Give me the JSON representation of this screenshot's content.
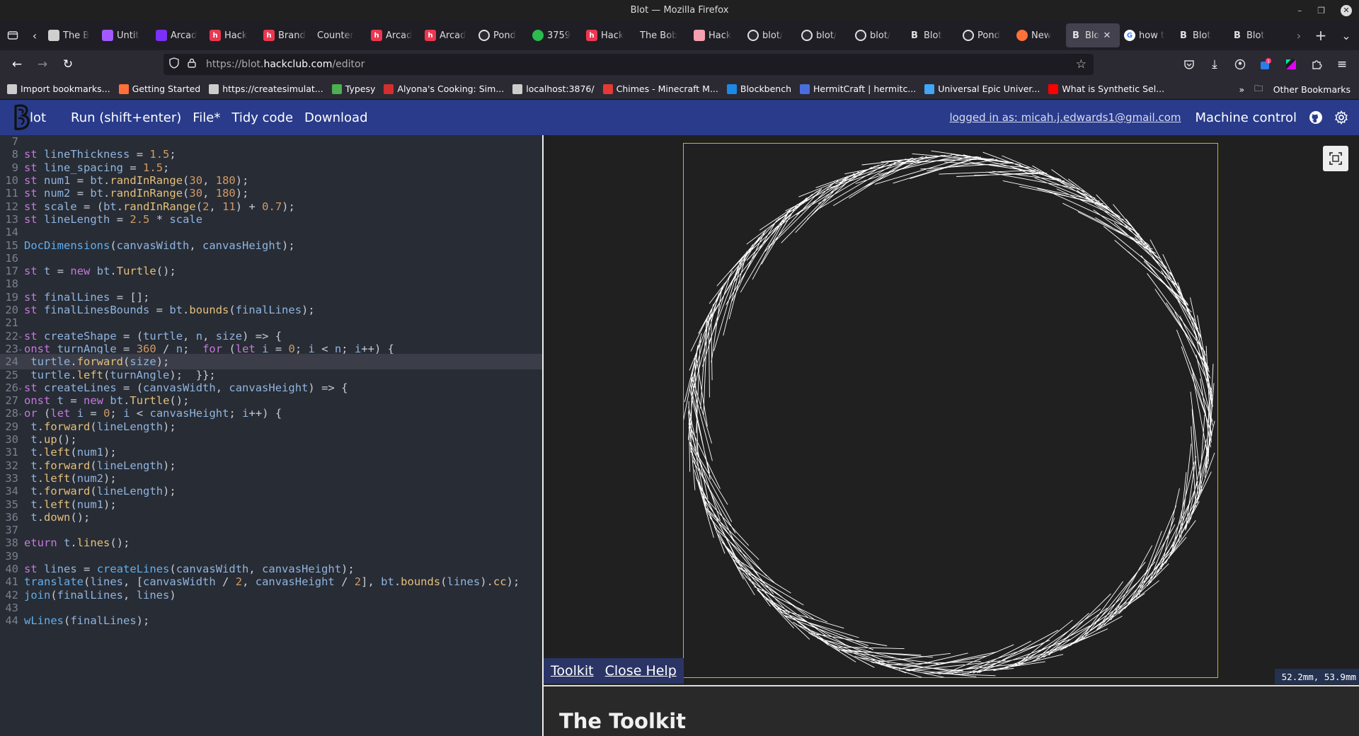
{
  "window": {
    "title": "Blot — Mozilla Firefox"
  },
  "tabs": [
    {
      "label": "The B",
      "icon": "cat-icon",
      "color": "#cfcfcf"
    },
    {
      "label": "Untit",
      "icon": "figma-icon",
      "color": "#a259ff"
    },
    {
      "label": "Arcad",
      "icon": "arcade-icon",
      "color": "#7b2ff7"
    },
    {
      "label": "Hack",
      "icon": "hackclub-icon",
      "color": "#ec3750"
    },
    {
      "label": "Brand",
      "icon": "hackclub-icon",
      "color": "#ec3750"
    },
    {
      "label": "Counter",
      "icon": "",
      "color": ""
    },
    {
      "label": "Arcad",
      "icon": "hackclub-icon",
      "color": "#ec3750"
    },
    {
      "label": "Arcad",
      "icon": "hackclub-icon",
      "color": "#ec3750"
    },
    {
      "label": "Pond",
      "icon": "github-icon",
      "color": "#e0e0e0"
    },
    {
      "label": "3759",
      "icon": "status-icon",
      "color": "#2dba4e"
    },
    {
      "label": "Hack",
      "icon": "hackclub-icon",
      "color": "#ec3750"
    },
    {
      "label": "The Bob",
      "icon": "",
      "color": ""
    },
    {
      "label": "Hack",
      "icon": "house-icon",
      "color": "#f4a0b0"
    },
    {
      "label": "blot/",
      "icon": "github-icon",
      "color": "#e0e0e0"
    },
    {
      "label": "blot/",
      "icon": "github-icon",
      "color": "#e0e0e0"
    },
    {
      "label": "blot/",
      "icon": "github-icon",
      "color": "#e0e0e0"
    },
    {
      "label": "Blot",
      "icon": "blot-icon",
      "color": "#e0e0e0"
    },
    {
      "label": "Pond",
      "icon": "github-icon",
      "color": "#e0e0e0"
    },
    {
      "label": "New",
      "icon": "firefox-icon",
      "color": "#ff7139"
    },
    {
      "label": "Blo",
      "icon": "blot-icon",
      "color": "#e0e0e0",
      "active": true
    },
    {
      "label": "how t",
      "icon": "google-icon",
      "color": "#4285f4"
    },
    {
      "label": "Blot",
      "icon": "blot-icon",
      "color": "#e0e0e0"
    },
    {
      "label": "Blot",
      "icon": "blot-icon",
      "color": "#e0e0e0"
    }
  ],
  "nav": {
    "url_scheme": "https://blot.",
    "url_host": "hackclub.com",
    "url_path": "/editor"
  },
  "bookmarks": [
    {
      "label": "Import bookmarks...",
      "color": "#cccccc"
    },
    {
      "label": "Getting Started",
      "color": "#ff7139"
    },
    {
      "label": "https://createsimulat...",
      "color": "#cccccc"
    },
    {
      "label": "Typesy",
      "color": "#4caf50"
    },
    {
      "label": "Alyona's Cooking: Sim...",
      "color": "#d32f2f"
    },
    {
      "label": "localhost:3876/",
      "color": "#cccccc"
    },
    {
      "label": "Chimes - Minecraft M...",
      "color": "#e53935"
    },
    {
      "label": "Blockbench",
      "color": "#1e88e5"
    },
    {
      "label": "HermitCraft | hermitc...",
      "color": "#4a6ee0"
    },
    {
      "label": "Universal Epic Univer...",
      "color": "#42a5f5"
    },
    {
      "label": "What is Synthetic Sel...",
      "color": "#ff0000"
    }
  ],
  "bookmarks_other": "Other Bookmarks",
  "app": {
    "logo_text": "lot",
    "menu": [
      "Run (shift+enter)",
      "File*",
      "Tidy code",
      "Download"
    ],
    "login": "logged in as: micah.j.edwards1@gmail.com",
    "machine_control": "Machine control"
  },
  "code_lines": [
    {
      "n": "7",
      "t": ""
    },
    {
      "n": "8",
      "t": "st lineThickness = 1.5;"
    },
    {
      "n": "9",
      "t": "st line_spacing = 1.5;"
    },
    {
      "n": "10",
      "t": "st num1 = bt.randInRange(30, 180);"
    },
    {
      "n": "11",
      "t": "st num2 = bt.randInRange(30, 180);"
    },
    {
      "n": "12",
      "t": "st scale = (bt.randInRange(2, 11) + 0.7);"
    },
    {
      "n": "13",
      "t": "st lineLength = 2.5 * scale"
    },
    {
      "n": "14",
      "t": ""
    },
    {
      "n": "15",
      "t": "DocDimensions(canvasWidth, canvasHeight);"
    },
    {
      "n": "16",
      "t": ""
    },
    {
      "n": "17",
      "t": "st t = new bt.Turtle();"
    },
    {
      "n": "18",
      "t": ""
    },
    {
      "n": "19",
      "t": "st finalLines = [];"
    },
    {
      "n": "20",
      "t": "st finalLinesBounds = bt.bounds(finalLines);"
    },
    {
      "n": "21",
      "t": ""
    },
    {
      "n": "22",
      "t": "st createShape = (turtle, n, size) => {",
      "fold": true
    },
    {
      "n": "23",
      "t": "onst turnAngle = 360 / n;  for (let i = 0; i < n; i++) {",
      "fold": true
    },
    {
      "n": "24",
      "t": " turtle.forward(size);",
      "hl": true
    },
    {
      "n": "25",
      "t": " turtle.left(turnAngle);  }};"
    },
    {
      "n": "26",
      "t": "st createLines = (canvasWidth, canvasHeight) => {",
      "fold": true
    },
    {
      "n": "27",
      "t": "onst t = new bt.Turtle();"
    },
    {
      "n": "28",
      "t": "or (let i = 0; i < canvasHeight; i++) {",
      "fold": true
    },
    {
      "n": "29",
      "t": " t.forward(lineLength);"
    },
    {
      "n": "30",
      "t": " t.up();"
    },
    {
      "n": "31",
      "t": " t.left(num1);"
    },
    {
      "n": "32",
      "t": " t.forward(lineLength);"
    },
    {
      "n": "33",
      "t": " t.left(num2);"
    },
    {
      "n": "34",
      "t": " t.forward(lineLength);"
    },
    {
      "n": "35",
      "t": " t.left(num1);"
    },
    {
      "n": "36",
      "t": " t.down();"
    },
    {
      "n": "37",
      "t": ""
    },
    {
      "n": "38",
      "t": "eturn t.lines();"
    },
    {
      "n": "39",
      "t": ""
    },
    {
      "n": "40",
      "t": "st lines = createLines(canvasWidth, canvasHeight);"
    },
    {
      "n": "41",
      "t": "translate(lines, [canvasWidth / 2, canvasHeight / 2], bt.bounds(lines).cc);"
    },
    {
      "n": "42",
      "t": "join(finalLines, lines)"
    },
    {
      "n": "43",
      "t": ""
    },
    {
      "n": "44",
      "t": "wLines(finalLines);"
    }
  ],
  "help": {
    "toolkit_label": "Toolkit",
    "close_label": "Close Help",
    "title": "The Toolkit"
  },
  "coords": "52.2mm,  53.9mm",
  "colors": {
    "appbar": "#293b8a",
    "canvas_border": "#c8c000",
    "editor_bg": "#282c34"
  }
}
